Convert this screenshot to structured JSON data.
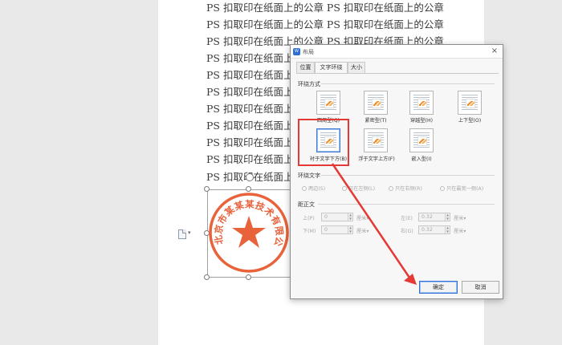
{
  "document": {
    "lines": [
      "PS 扣取印在纸面上的公章 PS 扣取印在纸面上的公章",
      "PS 扣取印在纸面上的公章 PS 扣取印在纸面上的公章",
      "PS 扣取印在纸面上的公章 PS 扣取印在纸面上的公章",
      "PS 扣取印在纸面上的公",
      "PS 扣取印在纸面上的公",
      "PS 扣取印在纸面上的",
      "PS 扣取印在纸面上的",
      "PS 扣取印在纸面上的",
      "PS 扣取印在纸面上的",
      "PS 扣取印在纸面上的",
      "PS 扣取印在纸面上"
    ],
    "seal": {
      "ring_text": "北京市某某某技术有限公司",
      "color": "#e8623a"
    }
  },
  "dialog": {
    "title": "布局",
    "app_icon_text": "W",
    "close_label": "×",
    "tabs": [
      "位置",
      "文字环绕",
      "大小"
    ],
    "active_tab": 1,
    "wrap_section_label": "环绕方式",
    "wrap_styles": [
      {
        "label": "四周型(Q)"
      },
      {
        "label": "紧密型(T)"
      },
      {
        "label": "穿越型(H)"
      },
      {
        "label": "上下型(O)"
      },
      {
        "label": "衬于文字下方(B)"
      },
      {
        "label": "浮于文字上方(F)"
      },
      {
        "label": "嵌入型(I)"
      }
    ],
    "selected_wrap": 4,
    "wrap_text_section_label": "环绕文字",
    "wrap_text_options": [
      "两边(S)",
      "只在左侧(L)",
      "只在右侧(R)",
      "只在最宽一侧(A)"
    ],
    "distance_section_label": "距正文",
    "distance": {
      "top": {
        "label": "上(P)",
        "value": "0",
        "unit": "厘米"
      },
      "bottom": {
        "label": "下(M)",
        "value": "0",
        "unit": "厘米"
      },
      "left": {
        "label": "左(E)",
        "value": "0.32",
        "unit": "厘米"
      },
      "right": {
        "label": "右(G)",
        "value": "0.32",
        "unit": "厘米"
      }
    },
    "ok_label": "确定",
    "cancel_label": "取消"
  },
  "colors": {
    "annotation": "#e53935",
    "selection": "#3f7ad6"
  }
}
